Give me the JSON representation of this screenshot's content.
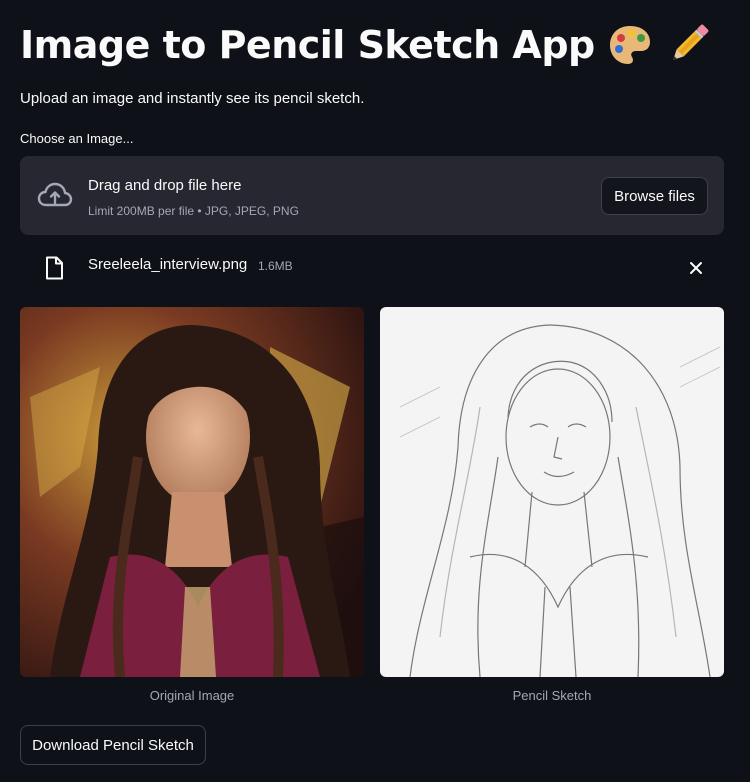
{
  "header": {
    "title": "Image to Pencil Sketch App",
    "title_emojis": [
      "palette-emoji",
      "pencil-emoji"
    ],
    "subtitle": "Upload an image and instantly see its pencil sketch."
  },
  "uploader": {
    "label": "Choose an Image...",
    "dropzone_title": "Drag and drop file here",
    "dropzone_limits": "Limit 200MB per file • JPG, JPEG, PNG",
    "browse_label": "Browse files",
    "icon": "cloud-upload-icon"
  },
  "uploaded_file": {
    "name": "Sreeleela_interview.png",
    "size": "1.6MB",
    "icon": "file-icon",
    "remove_icon": "close-icon"
  },
  "images": {
    "original_caption": "Original Image",
    "sketch_caption": "Pencil Sketch"
  },
  "actions": {
    "download_label": "Download Pencil Sketch"
  },
  "colors": {
    "background": "#0e1117",
    "dropzone": "#262730",
    "text": "#fafafa",
    "muted": "#a3a8b4",
    "border": "#3d404a"
  }
}
